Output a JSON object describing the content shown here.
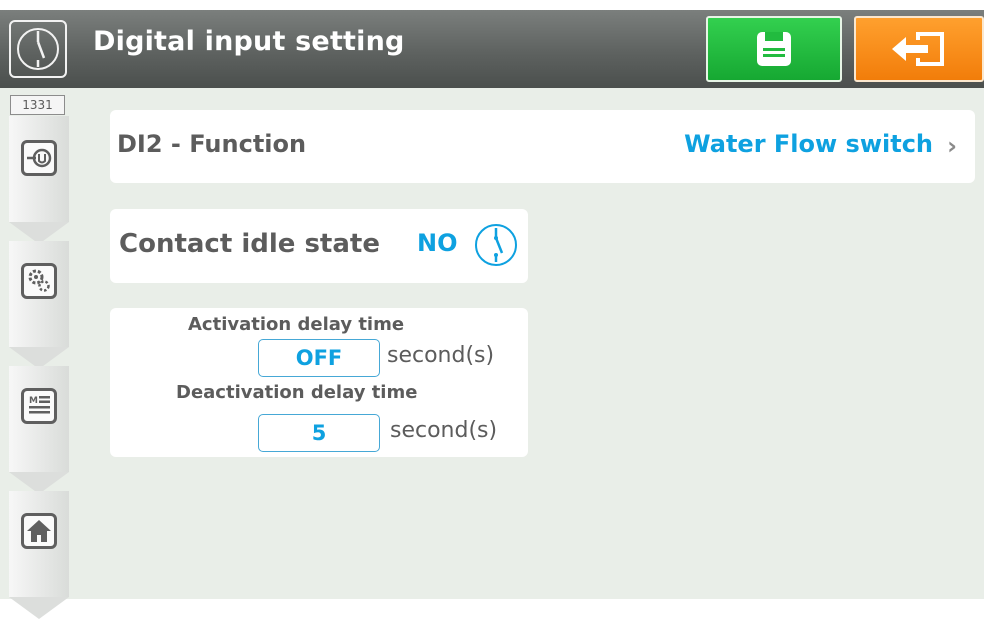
{
  "header": {
    "title": "Digital input setting",
    "icon": "contact-switch-icon",
    "save_icon": "floppy-disk-icon",
    "exit_icon": "exit-arrow-icon",
    "save_color": "#22bb3f",
    "exit_color": "#f58a16"
  },
  "sidebar": {
    "code": "1331",
    "items": [
      {
        "icon": "io-connector-icon"
      },
      {
        "icon": "gears-icon"
      },
      {
        "icon": "menu-list-icon"
      },
      {
        "icon": "home-icon"
      }
    ]
  },
  "function": {
    "label": "DI2 - Function",
    "value": "Water Flow switch"
  },
  "contact": {
    "label": "Contact idle state",
    "value": "NO",
    "icon": "normally-open-contact-icon"
  },
  "activation": {
    "label": "Activation delay time",
    "value": "OFF",
    "unit": "second(s)"
  },
  "deactivation": {
    "label": "Deactivation delay time",
    "value": "5",
    "unit": "second(s)"
  },
  "accent_color": "#0ea1e0"
}
